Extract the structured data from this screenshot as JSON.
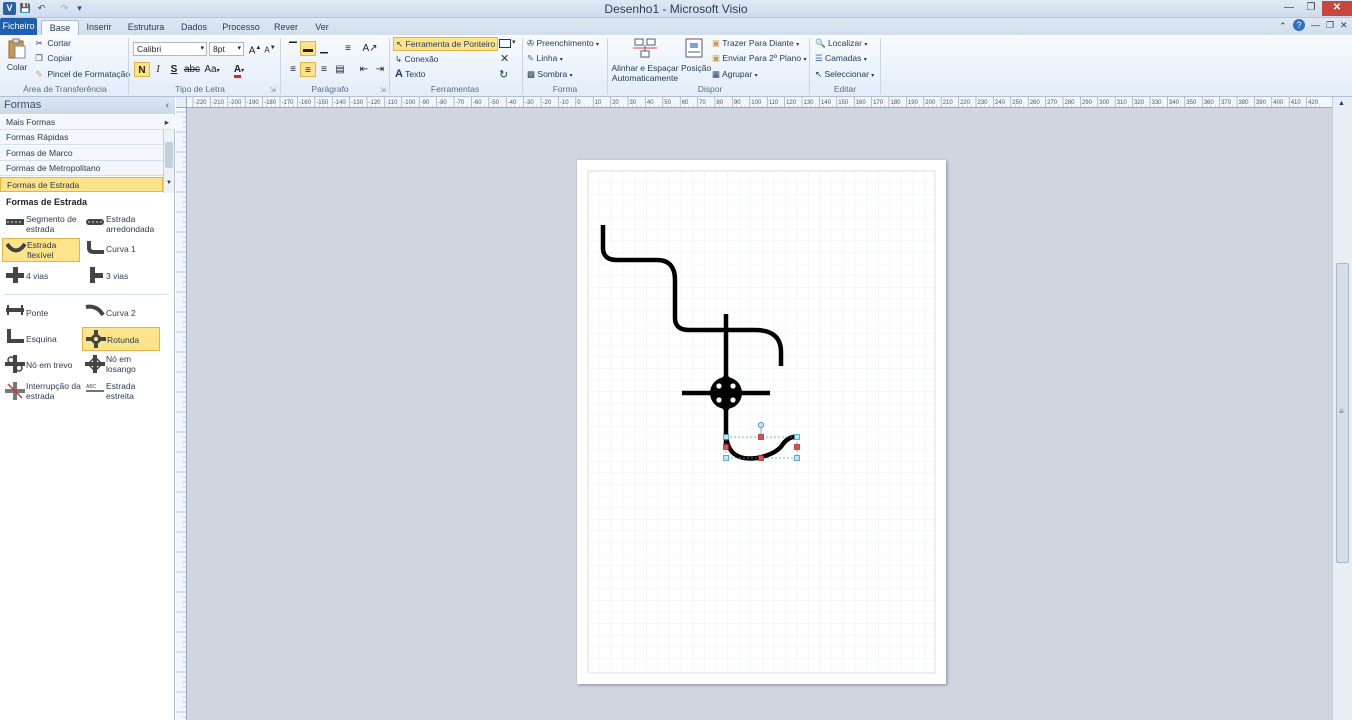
{
  "window": {
    "title": "Desenho1 - Microsoft Visio"
  },
  "tabs": [
    "Ficheiro",
    "Base",
    "Inserir",
    "Estrutura",
    "Dados",
    "Processo",
    "Rever",
    "Ver"
  ],
  "clipboard": {
    "paste": "Colar",
    "cut": "Cortar",
    "copy": "Copiar",
    "format_painter": "Pincel de Formatação",
    "group": "Área de Transferência"
  },
  "font": {
    "name": "Calibri",
    "size": "8pt",
    "bold": "N",
    "italic": "I",
    "underline": "S",
    "strike": "abc",
    "case": "Aa",
    "color": "A",
    "group": "Tipo de Letra"
  },
  "paragraph": {
    "group": "Parágrafo"
  },
  "tools": {
    "pointer": "Ferramenta de Ponteiro",
    "connector": "Conexão",
    "text": "Texto",
    "group": "Ferramentas"
  },
  "shape_style": {
    "fill": "Preenchimento",
    "line": "Linha",
    "shadow": "Sombra",
    "group": "Forma"
  },
  "arrange": {
    "align": "Alinhar e Espaçar Automaticamente",
    "position": "Posição",
    "front": "Trazer Para Diante",
    "back": "Enviar Para 2º Plano",
    "group_btn": "Agrupar",
    "group": "Dispor"
  },
  "editing": {
    "find": "Localizar",
    "layers": "Camadas",
    "select": "Seleccionar",
    "group": "Editar"
  },
  "shapes_pane": {
    "title": "Formas",
    "stencils": [
      "Mais Formas",
      "Formas Rápidas",
      "Formas de Marco",
      "Formas de Metropolitano",
      "Formas de Estrada"
    ],
    "section_title": "Formas de Estrada",
    "items": [
      {
        "label": "Segmento de estrada",
        "icon": "road-segment-icon"
      },
      {
        "label": "Estrada arredondada",
        "icon": "rounded-road-icon"
      },
      {
        "label": "Estrada flexível",
        "icon": "flexible-road-icon"
      },
      {
        "label": "Curva 1",
        "icon": "curve-1-icon"
      },
      {
        "label": "4 vias",
        "icon": "four-way-icon"
      },
      {
        "label": "3 vias",
        "icon": "three-way-icon"
      },
      {
        "label": "Ponte",
        "icon": "bridge-icon"
      },
      {
        "label": "Curva 2",
        "icon": "curve-2-icon"
      },
      {
        "label": "Esquina",
        "icon": "corner-icon"
      },
      {
        "label": "Rotunda",
        "icon": "roundabout-icon"
      },
      {
        "label": "Nó em trevo",
        "icon": "cloverleaf-icon"
      },
      {
        "label": "Nó em losango",
        "icon": "diamond-interchange-icon"
      },
      {
        "label": "Interrupção da estrada",
        "icon": "road-break-icon"
      },
      {
        "label": "Estrada estreita",
        "icon": "narrow-road-icon"
      }
    ]
  },
  "ruler": {
    "h_labels": [
      "-220",
      "-210",
      "-200",
      "-190",
      "-180",
      "-170",
      "-160",
      "-150",
      "-140",
      "-130",
      "-120",
      "-110",
      "-100",
      "-90",
      "-80",
      "-70",
      "-60",
      "-50",
      "-40",
      "-30",
      "-20",
      "-10",
      "0",
      "10",
      "20",
      "30",
      "40",
      "50",
      "60",
      "70",
      "80",
      "90",
      "100",
      "110",
      "120",
      "130",
      "140",
      "150",
      "160",
      "170",
      "180",
      "190",
      "200",
      "210",
      "220",
      "230",
      "240",
      "250",
      "260",
      "270",
      "280",
      "290",
      "300",
      "310",
      "320",
      "330",
      "340",
      "350",
      "360",
      "370",
      "380",
      "390",
      "400",
      "410",
      "420"
    ]
  },
  "colors": {
    "accent": "#1f5fb0",
    "highlight": "#fde48a",
    "canvas": "#cfd6df"
  }
}
